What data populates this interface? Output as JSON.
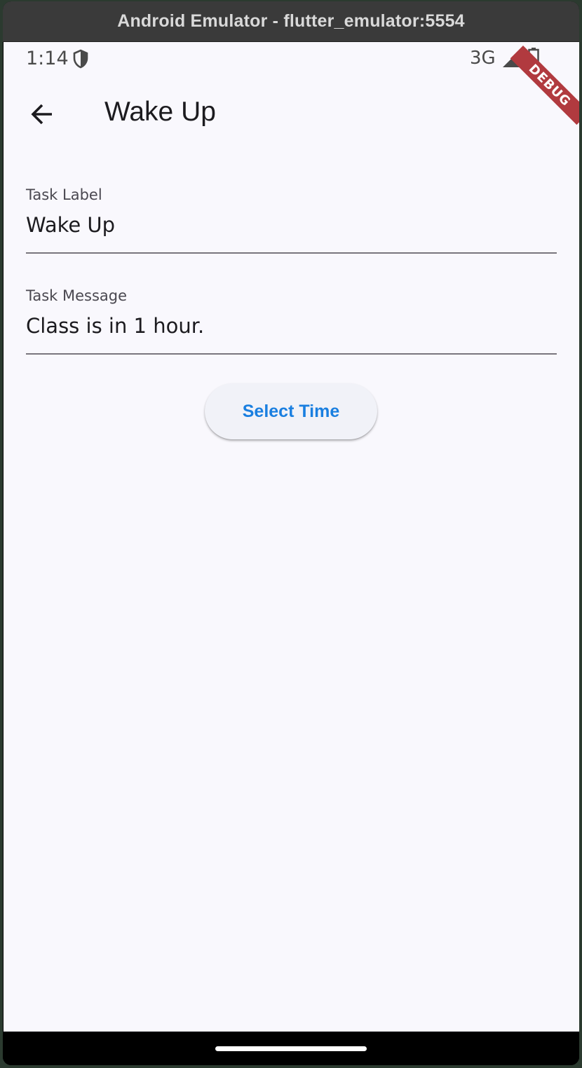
{
  "window": {
    "title": "Android Emulator - flutter_emulator:5554"
  },
  "status_bar": {
    "time": "1:14",
    "network": "3G",
    "icons": [
      "shield-icon",
      "signal-icon",
      "battery-icon"
    ]
  },
  "debug_banner": {
    "text": "DEBUG",
    "color": "#b13a3f"
  },
  "app_bar": {
    "title": "Wake Up",
    "back_icon": "arrow-back-icon"
  },
  "form": {
    "task_label": {
      "label": "Task Label",
      "value": "Wake Up"
    },
    "task_message": {
      "label": "Task Message",
      "value": "Class is in 1 hour."
    },
    "select_time_button": {
      "label": "Select Time",
      "color": "#1a7fe0"
    }
  },
  "colors": {
    "background": "#f9f8fd",
    "accent": "#1a7fe0"
  }
}
